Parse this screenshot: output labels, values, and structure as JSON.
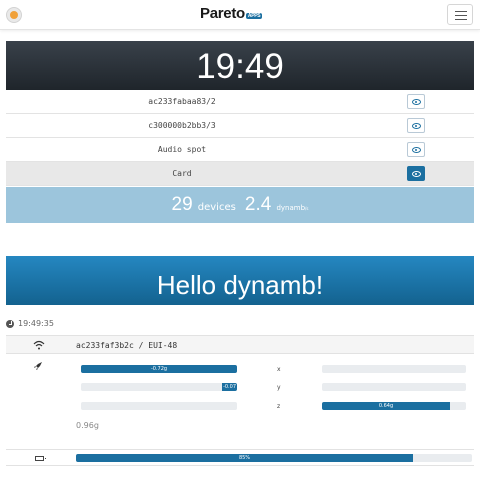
{
  "navbar": {
    "brand": "Pareto",
    "brand_sub": "APPS"
  },
  "clock": "19:49",
  "devices": [
    {
      "label": "ac233fabaa83/2",
      "selected": false
    },
    {
      "label": "c300000b2bb3/3",
      "selected": false
    },
    {
      "label": "Audio spot",
      "selected": false
    },
    {
      "label": "Card",
      "selected": true
    }
  ],
  "stats": {
    "devices_count": "29",
    "devices_label": "devices",
    "dynamb_rate": "2.4",
    "dynamb_label": "dynamb",
    "dynamb_unit": "/s"
  },
  "hello_title": "Hello dynamb!",
  "timestamp": "19:49:35",
  "device_id": "ac233faf3b2c / EUI-48",
  "acceleration": {
    "x": {
      "label": "x",
      "value": -0.72,
      "text": "-0.72g"
    },
    "y": {
      "label": "y",
      "value": -0.07,
      "text": "-0.07"
    },
    "z": {
      "label": "z",
      "value": 0.64,
      "text": "0.64g"
    },
    "magnitude": "0.96g"
  },
  "battery": {
    "percent": 85,
    "text": "85%"
  },
  "colors": {
    "accent": "#1b6fa0",
    "stats_bg": "#9cc5dc",
    "clock_bg": "#2b3137"
  }
}
